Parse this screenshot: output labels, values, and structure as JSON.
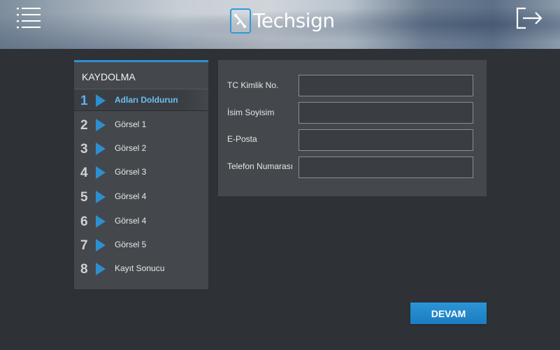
{
  "header": {
    "brand": "Techsign",
    "menu_icon": "menu-lines-icon",
    "exit_icon": "logout-icon"
  },
  "sidebar": {
    "title": "KAYDOLMA",
    "active_color": "#2d8fd0",
    "steps": [
      {
        "num": "1",
        "label": "Adları Doldurun",
        "active": true
      },
      {
        "num": "2",
        "label": "Görsel 1"
      },
      {
        "num": "3",
        "label": "Görsel 2"
      },
      {
        "num": "4",
        "label": "Görsel 3"
      },
      {
        "num": "5",
        "label": "Görsel 4"
      },
      {
        "num": "6",
        "label": "Görsel 4"
      },
      {
        "num": "7",
        "label": "Görsel 5"
      },
      {
        "num": "8",
        "label": "Kayıt Sonucu"
      }
    ]
  },
  "form": {
    "fields": [
      {
        "label": "TC Kimlik No.",
        "value": ""
      },
      {
        "label": "İsim Soyisim",
        "value": ""
      },
      {
        "label": "E-Posta",
        "value": ""
      },
      {
        "label": "Telefon Numarası",
        "value": ""
      }
    ]
  },
  "actions": {
    "continue_label": "DEVAM"
  }
}
